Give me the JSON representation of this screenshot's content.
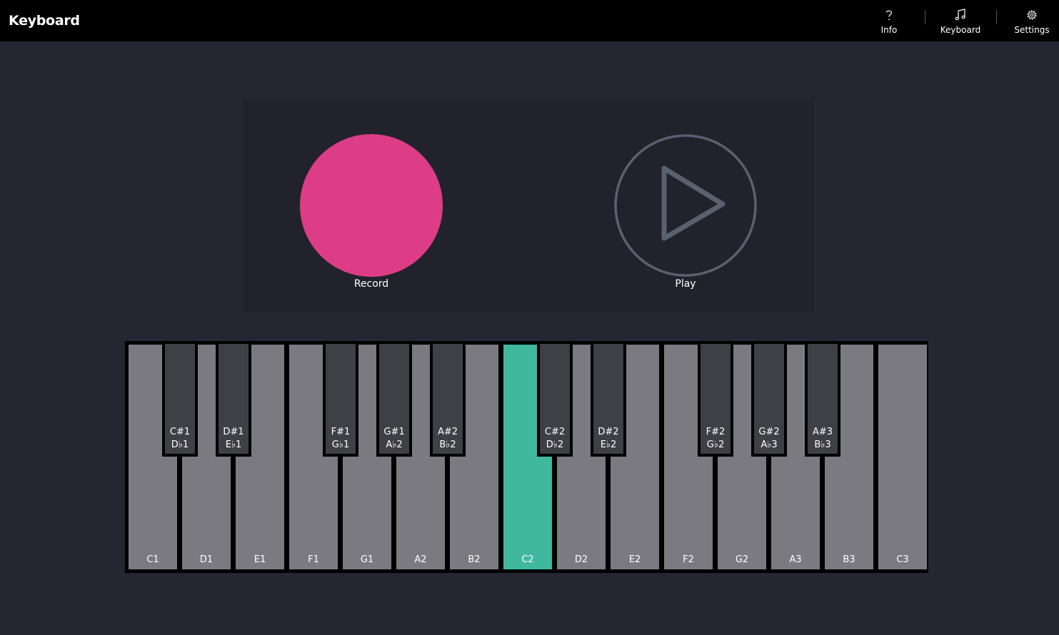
{
  "app": {
    "title": "Keyboard"
  },
  "nav": [
    {
      "label": "Info",
      "icon": "question-icon"
    },
    {
      "label": "Keyboard",
      "icon": "music-notes-icon"
    },
    {
      "label": "Settings",
      "icon": "gear-icon"
    }
  ],
  "transport": {
    "record_label": "Record",
    "play_label": "Play"
  },
  "colors": {
    "record": "#dd3d86",
    "active_key": "#3fb89e",
    "white_key": "#7a7a80",
    "black_key": "#3f3f46",
    "play_icon": "#5a6070"
  },
  "keyboard": {
    "white_keys": [
      "C1",
      "D1",
      "E1",
      "F1",
      "G1",
      "A2",
      "B2",
      "C2",
      "D2",
      "E2",
      "F2",
      "G2",
      "A3",
      "B3",
      "C3"
    ],
    "active_key": "C2",
    "black_keys": [
      {
        "sharp": "C#1",
        "flat": "D♭1"
      },
      {
        "sharp": "D#1",
        "flat": "E♭1"
      },
      {
        "sharp": "F#1",
        "flat": "G♭1"
      },
      {
        "sharp": "G#1",
        "flat": "A♭2"
      },
      {
        "sharp": "A#2",
        "flat": "B♭2"
      },
      {
        "sharp": "C#2",
        "flat": "D♭2"
      },
      {
        "sharp": "D#2",
        "flat": "E♭2"
      },
      {
        "sharp": "F#2",
        "flat": "G♭2"
      },
      {
        "sharp": "G#2",
        "flat": "A♭3"
      },
      {
        "sharp": "A#3",
        "flat": "B♭3"
      }
    ]
  }
}
